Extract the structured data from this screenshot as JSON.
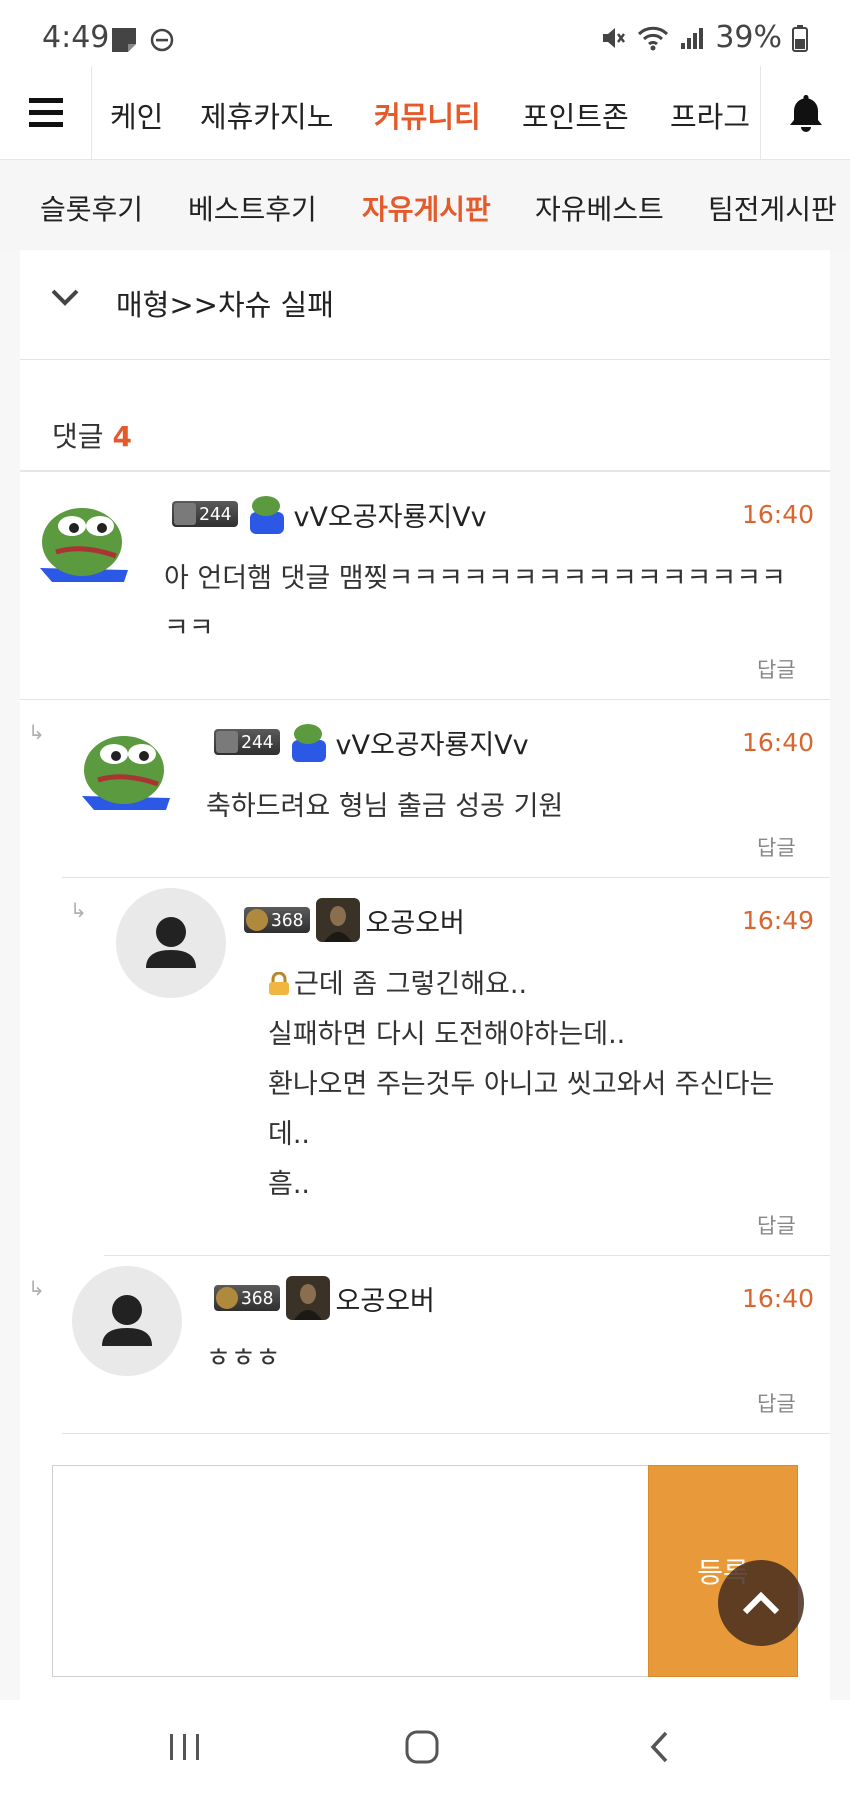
{
  "status_bar": {
    "time": "4:49",
    "battery": "39%"
  },
  "top_nav": {
    "items": [
      {
        "label": "케인",
        "active": false
      },
      {
        "label": "제휴카지노",
        "active": false
      },
      {
        "label": "커뮤니티",
        "active": true
      },
      {
        "label": "포인트존",
        "active": false
      },
      {
        "label": "프라그",
        "active": false
      }
    ]
  },
  "sub_nav": {
    "items": [
      {
        "label": "슬롯후기",
        "active": false
      },
      {
        "label": "베스트후기",
        "active": false
      },
      {
        "label": "자유게시판",
        "active": true
      },
      {
        "label": "자유베스트",
        "active": false
      },
      {
        "label": "팀전게시판",
        "active": false
      }
    ]
  },
  "post": {
    "title": "매형>>차슈 실패"
  },
  "comments_section": {
    "label": "댓글",
    "count": "4"
  },
  "comments": [
    {
      "level": "244",
      "nickname": "vV오공자룡지Vv",
      "time": "16:40",
      "lines": [
        "아 언더햄 댓글 맴찢ㅋㅋㅋㅋㅋㅋㅋㅋㅋㅋㅋㅋㅋㅋㅋㅋ",
        "ㅋㅋ"
      ],
      "reply_label": "답글"
    },
    {
      "level": "244",
      "nickname": "vV오공자룡지Vv",
      "time": "16:40",
      "lines": [
        "축하드려요 형님 출금 성공 기원"
      ],
      "reply_label": "답글"
    },
    {
      "level": "368",
      "nickname": "오공오버",
      "time": "16:49",
      "lines": [
        "근데 좀 그렇긴해요..",
        "실패하면 다시 도전해야하는데..",
        "환나오면 주는것두 아니고 씻고와서 주신다는",
        "데..",
        "흠.."
      ],
      "reply_label": "답글"
    },
    {
      "level": "368",
      "nickname": "오공오버",
      "time": "16:40",
      "lines": [
        "ㅎㅎㅎ"
      ],
      "reply_label": "답글"
    }
  ],
  "editor": {
    "value": "",
    "submit_label": "등록"
  },
  "colors": {
    "accent": "#e55a2b",
    "submit": "#e8993a",
    "time": "#d9662f"
  }
}
